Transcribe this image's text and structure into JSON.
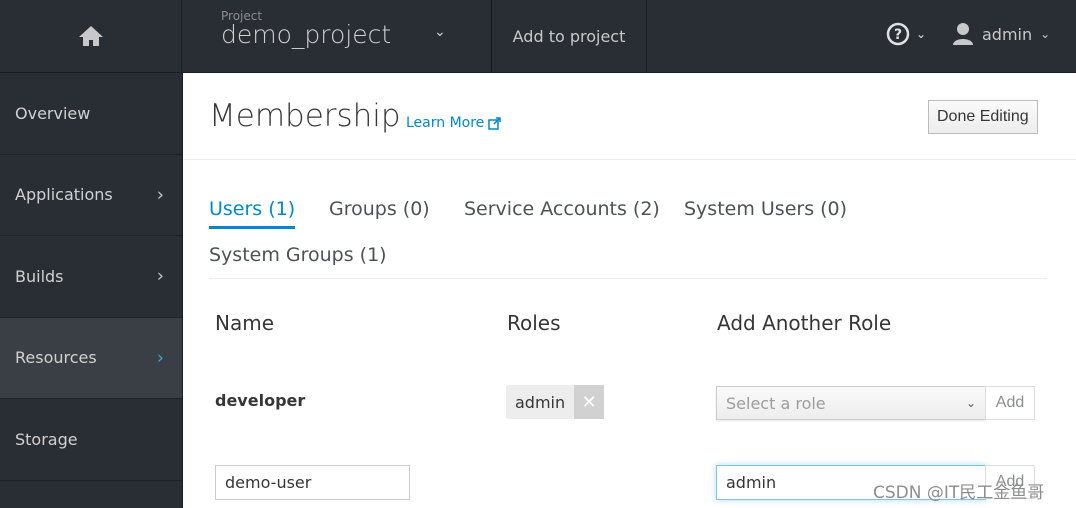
{
  "topbar": {
    "home_icon": "home-icon",
    "project_label": "Project",
    "project_name": "demo_project",
    "add_to_project": "Add to project",
    "help_icon": "question-circle-icon",
    "user_icon": "user-icon",
    "username": "admin"
  },
  "sidebar": {
    "items": [
      {
        "label": "Overview",
        "has_arrow": false,
        "active": false
      },
      {
        "label": "Applications",
        "has_arrow": true,
        "active": false
      },
      {
        "label": "Builds",
        "has_arrow": true,
        "active": false
      },
      {
        "label": "Resources",
        "has_arrow": true,
        "active": true
      },
      {
        "label": "Storage",
        "has_arrow": false,
        "active": false
      }
    ]
  },
  "page": {
    "title": "Membership",
    "learn_more": "Learn More",
    "done_editing": "Done Editing"
  },
  "tabs": [
    {
      "label": "Users (1)",
      "active": true
    },
    {
      "label": "Groups (0)",
      "active": false
    },
    {
      "label": "Service Accounts (2)",
      "active": false
    },
    {
      "label": "System Users (0)",
      "active": false
    },
    {
      "label": "System Groups (1)",
      "active": false
    }
  ],
  "table": {
    "headers": [
      "Name",
      "Roles",
      "Add Another Role"
    ],
    "rows": [
      {
        "name": "developer",
        "roles": [
          "admin"
        ],
        "select_placeholder": "Select a role",
        "add_label": "Add"
      }
    ],
    "new_row": {
      "name_value": "demo-user",
      "role_value": "admin",
      "add_label": "Add"
    }
  },
  "watermark": "CSDN @IT民工金鱼哥",
  "colors": {
    "accent": "#0088ce",
    "nav_bg": "#292e34",
    "active_nav_bg": "#393f44"
  }
}
